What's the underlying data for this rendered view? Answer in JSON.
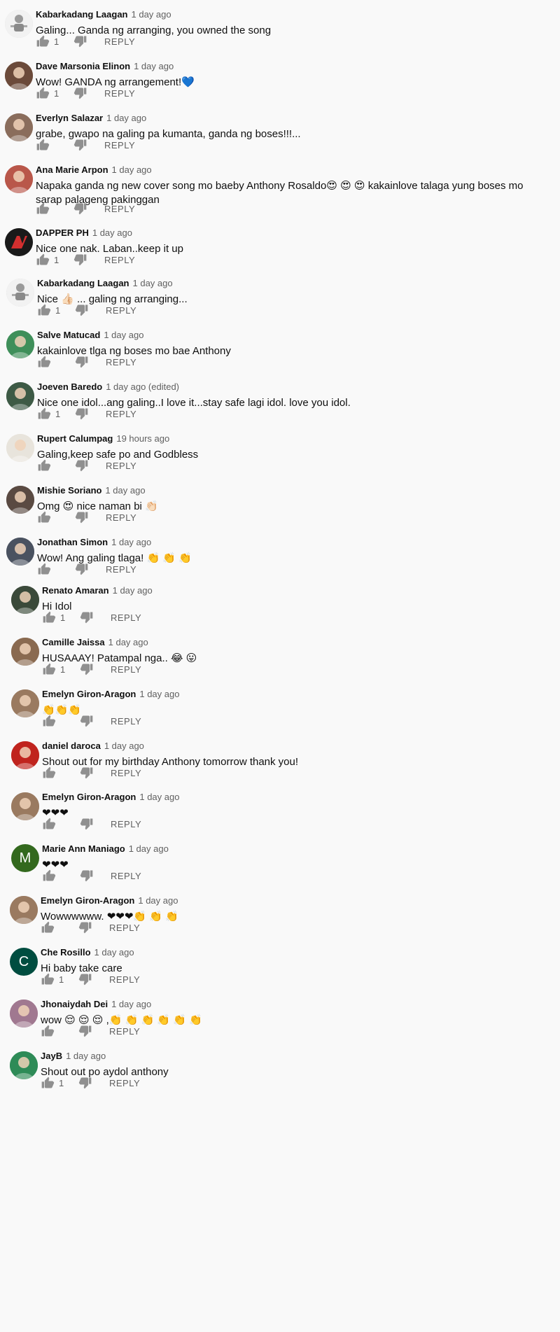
{
  "comments": [
    {
      "author": "Kabarkadang Laagan",
      "time": "1 day ago",
      "text": "Galing... Ganda ng arranging, you owned the song",
      "likes": "1",
      "reply": "REPLY",
      "avatar": "robot-avatar",
      "color": "#d9d9d9"
    },
    {
      "author": "Dave Marsonia Elinon",
      "time": "1 day ago",
      "text": "Wow! GANDA ng arrangement!💙",
      "likes": "1",
      "reply": "REPLY",
      "avatar": "photo",
      "color": "#6b4a3a"
    },
    {
      "author": "Everlyn Salazar",
      "time": "1 day ago",
      "text": "grabe, gwapo na galing pa kumanta, ganda ng boses!!!...",
      "likes": "",
      "reply": "REPLY",
      "avatar": "photo",
      "color": "#8a6d5c"
    },
    {
      "author": "Ana Marie Arpon",
      "time": "1 day ago",
      "text": "Napaka ganda ng new cover song mo baeby Anthony Rosaldo😍 😍 😍  kakainlove talaga yung boses mo sarap palageng pakinggan",
      "likes": "",
      "reply": "REPLY",
      "avatar": "photo",
      "color": "#b9574a"
    },
    {
      "author": "DAPPER PH",
      "time": "1 day ago",
      "text": "Nice one nak. Laban..keep it up",
      "likes": "1",
      "reply": "REPLY",
      "avatar": "logo",
      "color": "#1a1a1a"
    },
    {
      "author": "Kabarkadang Laagan",
      "time": "1 day ago",
      "text": "Nice 👍🏻 ... galing ng arranging...",
      "likes": "1",
      "reply": "REPLY",
      "avatar": "robot-avatar",
      "color": "#d9d9d9"
    },
    {
      "author": "Salve Matucad",
      "time": "1 day ago",
      "text": "kakainlove tlga ng boses mo bae Anthony",
      "likes": "",
      "reply": "REPLY",
      "avatar": "photo",
      "color": "#3f8f5a"
    },
    {
      "author": "Joeven Baredo",
      "time": "1 day ago (edited)",
      "text": "Nice one idol...ang galing..I love it...stay safe lagi idol. love you idol.",
      "likes": "1",
      "reply": "REPLY",
      "avatar": "photo",
      "color": "#3d5a45"
    },
    {
      "author": "Rupert Calumpag",
      "time": "19 hours ago",
      "text": "Galing,keep safe po and Godbless",
      "likes": "",
      "reply": "REPLY",
      "avatar": "photo",
      "color": "#e8e4dc"
    },
    {
      "author": "Mishie Soriano",
      "time": "1 day ago",
      "text": "Omg 😍  nice naman bi 👏🏻",
      "likes": "",
      "reply": "REPLY",
      "avatar": "photo",
      "color": "#5a4a42"
    },
    {
      "author": "Jonathan Simon",
      "time": "1 day ago",
      "text": "Wow! Ang galing tlaga! 👏 👏 👏",
      "likes": "",
      "reply": "REPLY",
      "avatar": "photo",
      "color": "#4a5260"
    },
    {
      "author": "Renato Amaran",
      "time": "1 day ago",
      "text": "Hi Idol",
      "likes": "1",
      "reply": "REPLY",
      "avatar": "photo",
      "color": "#3b4a3a"
    },
    {
      "author": "Camille Jaissa",
      "time": "1 day ago",
      "text": "HUSAAAY! Patampal nga.. 😂 😛",
      "likes": "1",
      "reply": "REPLY",
      "avatar": "photo",
      "color": "#8a6a50"
    },
    {
      "author": "Emelyn Giron-Aragon",
      "time": "1 day ago",
      "text": "👏👏👏",
      "likes": "",
      "reply": "REPLY",
      "avatar": "photo",
      "color": "#9a7a60"
    },
    {
      "author": "daniel daroca",
      "time": "1 day ago",
      "text": "Shout out for my birthday Anthony tomorrow thank you!",
      "likes": "",
      "reply": "REPLY",
      "avatar": "photo",
      "color": "#c0241e"
    },
    {
      "author": "Emelyn Giron-Aragon",
      "time": "1 day ago",
      "text": "❤❤❤",
      "likes": "",
      "reply": "REPLY",
      "avatar": "photo",
      "color": "#9a7a60"
    },
    {
      "author": "Marie Ann Maniago",
      "time": "1 day ago",
      "text": "❤❤❤",
      "likes": "",
      "reply": "REPLY",
      "avatar": "letter",
      "letter": "M",
      "color": "#33691e"
    },
    {
      "author": "Emelyn Giron-Aragon",
      "time": "1 day ago",
      "text": "Wowwwwww. ❤❤❤👏 👏 👏",
      "likes": "",
      "reply": "REPLY",
      "avatar": "photo",
      "color": "#9a7a60"
    },
    {
      "author": "Che Rosillo",
      "time": "1 day ago",
      "text": "Hi baby take care",
      "likes": "1",
      "reply": "REPLY",
      "avatar": "letter",
      "letter": "C",
      "color": "#004d40"
    },
    {
      "author": "Jhonaiydah Dei",
      "time": "1 day ago",
      "text": "wow 😌 😌 😌 ,👏 👏 👏 👏 👏 👏",
      "likes": "",
      "reply": "REPLY",
      "avatar": "photo",
      "color": "#a07890"
    },
    {
      "author": "JayB",
      "time": "1 day ago",
      "text": "Shout out po aydol anthony",
      "likes": "1",
      "reply": "REPLY",
      "avatar": "photo",
      "color": "#2e8b57"
    }
  ]
}
